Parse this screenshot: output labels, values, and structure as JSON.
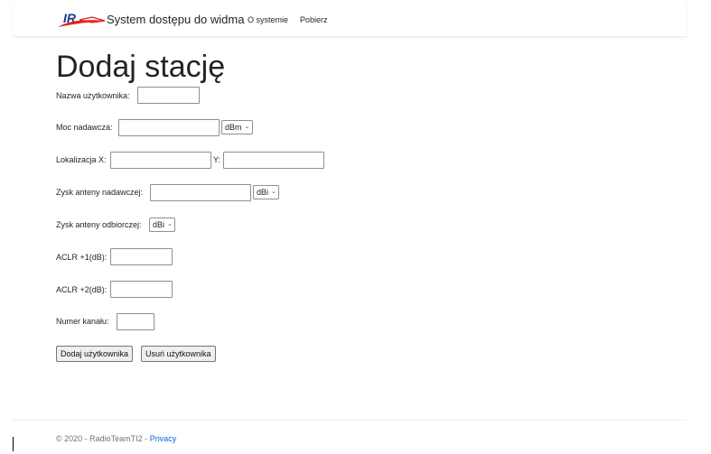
{
  "header": {
    "brand": "System dostępu do widma",
    "nav": {
      "about": "O systemie",
      "download": "Pobierz"
    }
  },
  "colors": {
    "logo_red": "#e32119",
    "logo_blue": "#1b3a8f",
    "link": "#0366d6"
  },
  "form": {
    "title": "Dodaj stację",
    "user_name_label": "Nazwa użytkownika:",
    "user_name_value": "",
    "tx_power_label": "Moc nadawcza:",
    "tx_power_value": "",
    "tx_power_unit": "dBm",
    "location_x_label": "Lokalizacja X:",
    "location_x_value": "",
    "location_y_label": "Y:",
    "location_y_value": "",
    "tx_gain_label": "Zysk anteny nadawczej:",
    "tx_gain_value": "",
    "tx_gain_unit": "dBi",
    "rx_gain_label": "Zysk anteny odbiorczej:",
    "rx_gain_unit": "dBi",
    "aclr1_label": "ACLR +1(dB):",
    "aclr1_value": "",
    "aclr2_label": "ACLR +2(dB):",
    "aclr2_value": "",
    "channel_label": "Numer kanału:",
    "channel_value": "",
    "add_button": "Dodaj użytkownika",
    "remove_button": "Usuń użytkownika"
  },
  "footer": {
    "copyright": "© 2020 - RadioTeamTI2 - ",
    "privacy": "Privacy"
  }
}
